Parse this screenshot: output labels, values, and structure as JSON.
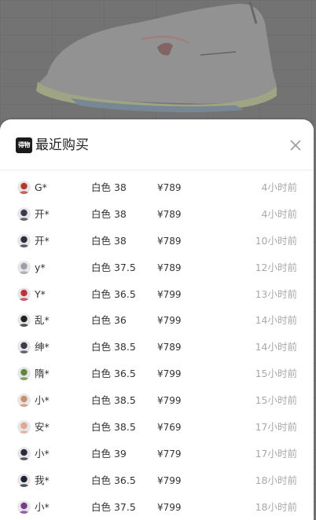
{
  "header": {
    "logo_text": "得物",
    "title": "最近购买"
  },
  "purchases": [
    {
      "name": "G*",
      "spec": "白色 38",
      "price": "¥789",
      "time": "4小时前",
      "avatar_color": "#b23a2a"
    },
    {
      "name": "开*",
      "spec": "白色 38",
      "price": "¥789",
      "time": "4小时前",
      "avatar_color": "#3a3a4a"
    },
    {
      "name": "开*",
      "spec": "白色 38",
      "price": "¥789",
      "time": "10小时前",
      "avatar_color": "#2e2e3a"
    },
    {
      "name": "y*",
      "spec": "白色 37.5",
      "price": "¥789",
      "time": "12小时前",
      "avatar_color": "#9aa0a8"
    },
    {
      "name": "Y*",
      "spec": "白色 36.5",
      "price": "¥799",
      "time": "13小时前",
      "avatar_color": "#c0303a"
    },
    {
      "name": "乱*",
      "spec": "白色 36",
      "price": "¥799",
      "time": "14小时前",
      "avatar_color": "#222222"
    },
    {
      "name": "绅*",
      "spec": "白色 38.5",
      "price": "¥789",
      "time": "14小时前",
      "avatar_color": "#3a3a48"
    },
    {
      "name": "隋*",
      "spec": "白色 36.5",
      "price": "¥799",
      "time": "15小时前",
      "avatar_color": "#5d8a3a"
    },
    {
      "name": "小*",
      "spec": "白色 38.5",
      "price": "¥799",
      "time": "15小时前",
      "avatar_color": "#c9906a"
    },
    {
      "name": "安*",
      "spec": "白色 38.5",
      "price": "¥769",
      "time": "17小时前",
      "avatar_color": "#e0a890"
    },
    {
      "name": "小*",
      "spec": "白色 39",
      "price": "¥779",
      "time": "17小时前",
      "avatar_color": "#2a2a3a"
    },
    {
      "name": "我*",
      "spec": "白色 36.5",
      "price": "¥799",
      "time": "18小时前",
      "avatar_color": "#1c2430"
    },
    {
      "name": "小*",
      "spec": "白色 37.5",
      "price": "¥799",
      "time": "18小时前",
      "avatar_color": "#7a3a8a"
    }
  ],
  "colors": {
    "sheet_bg": "#ffffff",
    "time_text": "#a8a8b0",
    "primary_text": "#333333"
  }
}
